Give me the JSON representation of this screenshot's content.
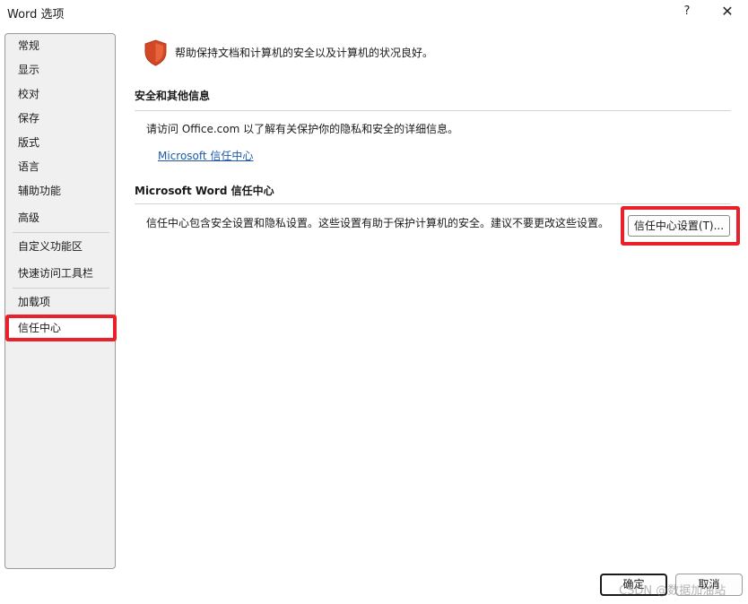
{
  "window": {
    "title": "Word 选项",
    "help_label": "?",
    "close_label": "✕"
  },
  "sidebar": {
    "items": [
      {
        "label": "常规"
      },
      {
        "label": "显示"
      },
      {
        "label": "校对"
      },
      {
        "label": "保存"
      },
      {
        "label": "版式"
      },
      {
        "label": "语言"
      },
      {
        "label": "辅助功能"
      },
      {
        "label": "高级"
      },
      {
        "label": "自定义功能区"
      },
      {
        "label": "快速访问工具栏"
      },
      {
        "label": "加载项"
      },
      {
        "label": "信任中心"
      }
    ],
    "selected": "信任中心"
  },
  "main": {
    "intro": "帮助保持文档和计算机的安全以及计算机的状况良好。",
    "section1": {
      "heading": "安全和其他信息",
      "text": "请访问 Office.com 以了解有关保护你的隐私和安全的详细信息。",
      "link": "Microsoft 信任中心"
    },
    "section2": {
      "heading": "Microsoft Word 信任中心",
      "text": "信任中心包含安全设置和隐私设置。这些设置有助于保护计算机的安全。建议不要更改这些设置。",
      "button": "信任中心设置(T)..."
    }
  },
  "footer": {
    "ok": "确定",
    "cancel": "取消"
  },
  "watermark": "CSDN @数据加油站",
  "colors": {
    "highlight": "#e8212b",
    "shield": "#d24726",
    "link": "#1f5aa8"
  }
}
